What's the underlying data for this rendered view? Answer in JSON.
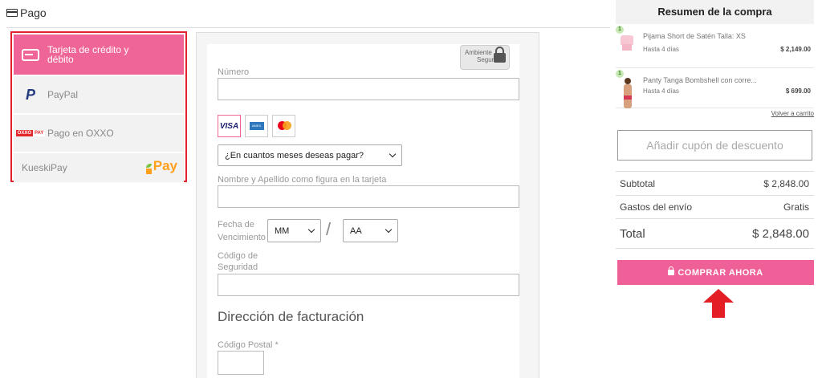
{
  "header": {
    "title": "Pago"
  },
  "payment_methods": [
    {
      "label": "Tarjeta de crédito y débito",
      "icon": "credit-card-icon",
      "active": true
    },
    {
      "label": "PayPal",
      "icon": "paypal-icon",
      "active": false
    },
    {
      "label": "Pago en OXXO",
      "icon": "oxxo-pay-icon",
      "active": false
    },
    {
      "label": "KueskiPay",
      "icon": "kueski-pay-logo",
      "logo_text": "Pay",
      "active": false
    }
  ],
  "card_form": {
    "secure_badge": {
      "line1": "Ambiente",
      "line2": "Seguro"
    },
    "number_label": "Número",
    "number_value": "",
    "card_brands": [
      "VISA",
      "AMEX",
      "Mastercard"
    ],
    "installments_value": "¿En cuantos meses deseas pagar?",
    "name_label": "Nombre y Apellido como figura en la tarjeta",
    "name_value": "",
    "expiry_label_1": "Fecha de",
    "expiry_label_2": "Vencimiento",
    "month_value": "MM",
    "year_value": "AA",
    "cvv_label_1": "Código de",
    "cvv_label_2": "Seguridad",
    "cvv_value": "",
    "billing_title": "Dirección de facturación",
    "postal_label": "Código Postal *",
    "postal_value": ""
  },
  "summary": {
    "title": "Resumen de la compra",
    "items": [
      {
        "qty": "1",
        "name": "Pijama Short de Satén Talla: XS",
        "delivery": "Hasta 4 días",
        "price": "$ 2,149.00"
      },
      {
        "qty": "1",
        "name": "Panty Tanga Bombshell con corre...",
        "delivery": "Hasta 4 días",
        "price": "$ 699.00"
      }
    ],
    "back_link": "Volver a carrito",
    "coupon_label": "Añadir cupón de descuento",
    "subtotal_label": "Subtotal",
    "subtotal_value": "$ 2,848.00",
    "shipping_label": "Gastos del envío",
    "shipping_value": "Gratis",
    "total_label": "Total",
    "total_value": "$ 2,848.00",
    "buy_button": "COMPRAR AHORA"
  },
  "colors": {
    "accent": "#ef6098",
    "highlight_border": "#e0212b",
    "arrow": "#e31e24"
  }
}
